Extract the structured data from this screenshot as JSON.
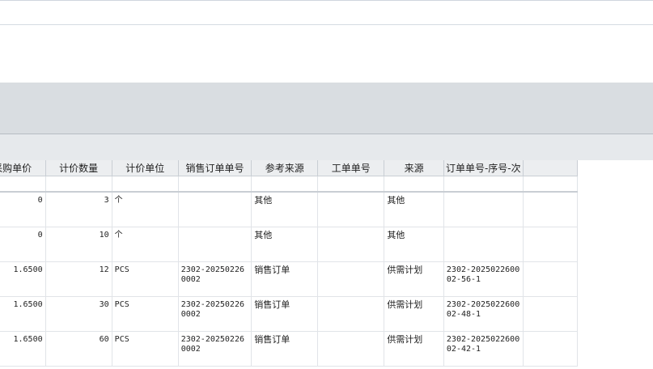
{
  "columns": [
    "采购单价",
    "计价数量",
    "计价单位",
    "销售订单单号",
    "参考来源",
    "工单单号",
    "来源",
    "订单单号-序号-次"
  ],
  "rows": [
    {
      "unit_price": "0",
      "price_qty": "3",
      "price_unit": "个",
      "sales_order_no": "",
      "ref_source": "其他",
      "work_order_no": "",
      "source": "其他",
      "order_seq": ""
    },
    {
      "unit_price": "0",
      "price_qty": "10",
      "price_unit": "个",
      "sales_order_no": "",
      "ref_source": "其他",
      "work_order_no": "",
      "source": "其他",
      "order_seq": ""
    },
    {
      "unit_price": "1.6500",
      "price_qty": "12",
      "price_unit": "PCS",
      "sales_order_no": "2302-202502260002",
      "ref_source": "销售订单",
      "work_order_no": "",
      "source": "供需计划",
      "order_seq": "2302-202502260002-56-1"
    },
    {
      "unit_price": "1.6500",
      "price_qty": "30",
      "price_unit": "PCS",
      "sales_order_no": "2302-202502260002",
      "ref_source": "销售订单",
      "work_order_no": "",
      "source": "供需计划",
      "order_seq": "2302-202502260002-48-1"
    },
    {
      "unit_price": "1.6500",
      "price_qty": "60",
      "price_unit": "PCS",
      "sales_order_no": "2302-202502260002",
      "ref_source": "销售订单",
      "work_order_no": "",
      "source": "供需计划",
      "order_seq": "2302-202502260002-42-1"
    }
  ]
}
